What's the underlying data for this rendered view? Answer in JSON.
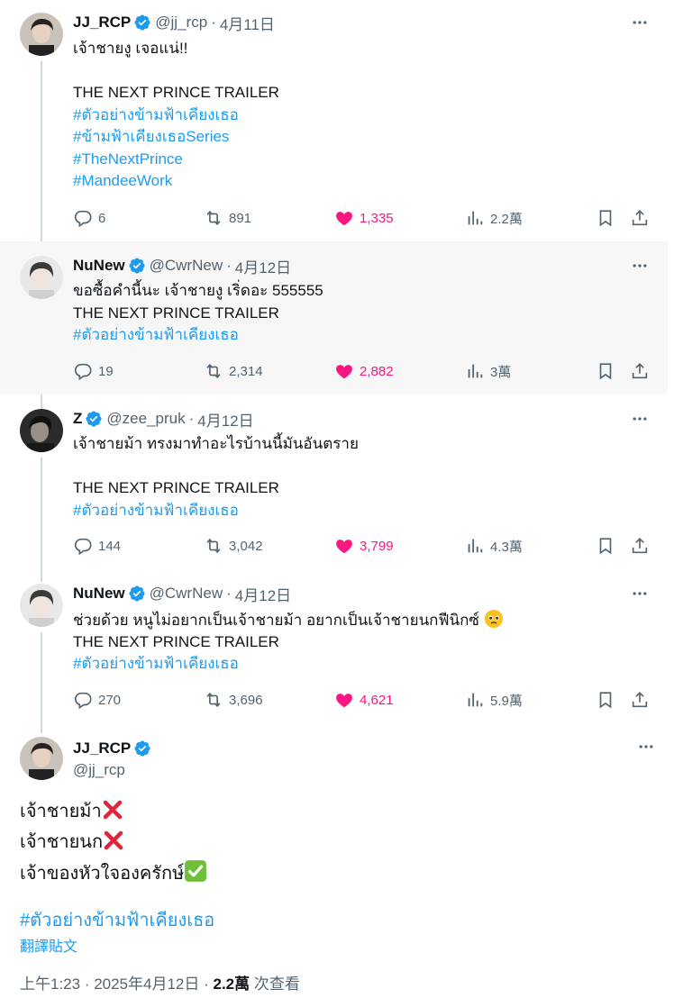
{
  "tweets": [
    {
      "name": "JJ_RCP",
      "handle": "@jj_rcp",
      "date": "4月11日",
      "lines": [
        "เจ้าชายงู เจอแน่!!",
        "",
        "THE NEXT PRINCE TRAILER"
      ],
      "tags": [
        "#ตัวอย่างข้ามฟ้าเคียงเธอ",
        "#ข้ามฟ้าเคียงเธอSeries",
        "#TheNextPrince",
        "#MandeeWork"
      ],
      "replies": "6",
      "retweets": "891",
      "likes": "1,335",
      "views": "2.2萬"
    },
    {
      "name": "NuNew",
      "handle": "@CwrNew",
      "date": "4月12日",
      "lines": [
        "ขอซื้อคำนี้นะ เจ้าชายงู เริ่ดอะ 555555",
        "THE NEXT PRINCE TRAILER"
      ],
      "tags": [
        "#ตัวอย่างข้ามฟ้าเคียงเธอ"
      ],
      "replies": "19",
      "retweets": "2,314",
      "likes": "2,882",
      "views": "3萬"
    },
    {
      "name": "Z",
      "handle": "@zee_pruk",
      "date": "4月12日",
      "lines": [
        "เจ้าชายม้า ทรงมาทำอะไรบ้านนี้มันอันตราย",
        "",
        "THE NEXT PRINCE TRAILER"
      ],
      "tags": [
        "#ตัวอย่างข้ามฟ้าเคียงเธอ"
      ],
      "replies": "144",
      "retweets": "3,042",
      "likes": "3,799",
      "views": "4.3萬"
    },
    {
      "name": "NuNew",
      "handle": "@CwrNew",
      "date": "4月12日",
      "lines": [
        "ช่วยด้วย หนูไม่อยากเป็นเจ้าชายม้า อยากเป็นเจ้าชายนกฟีนิกซ์",
        "THE NEXT PRINCE TRAILER"
      ],
      "tags": [
        "#ตัวอย่างข้ามฟ้าเคียงเธอ"
      ],
      "replies": "270",
      "retweets": "3,696",
      "likes": "4,621",
      "views": "5.9萬"
    }
  ],
  "main": {
    "name": "JJ_RCP",
    "handle": "@jj_rcp",
    "lines": [
      "เจ้าชายม้า",
      "เจ้าชายนก",
      "เจ้าของหัวใจองครักษ์"
    ],
    "tag": "#ตัวอย่างข้ามฟ้าเคียงเธอ",
    "translate": "翻譯貼文",
    "time": "上午1:23 · 2025年4月12日 · ",
    "views": "2.2萬",
    "views_label": " 次查看"
  },
  "colors": {
    "accent": "#1d9bf0",
    "like": "#f91880",
    "muted": "#536471",
    "highlight_bg": "#f7f7f7"
  }
}
